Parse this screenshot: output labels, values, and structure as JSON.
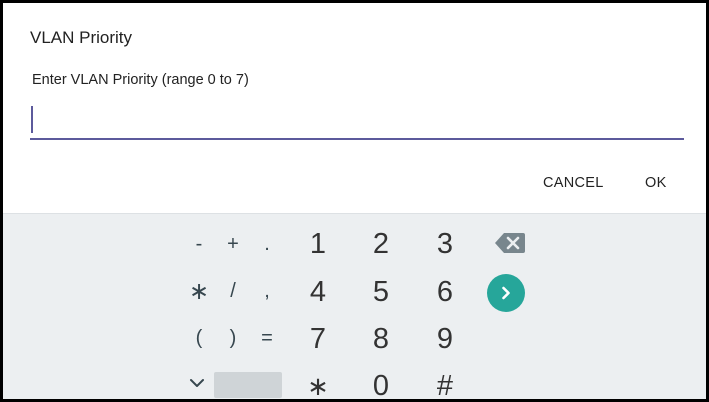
{
  "dialog": {
    "title": "VLAN Priority",
    "message": "Enter VLAN Priority (range 0 to 7)",
    "input_value": "",
    "cancel_label": "CANCEL",
    "ok_label": "OK"
  },
  "keyboard": {
    "row1": {
      "sym1": "-",
      "sym2": "+",
      "sym3": ".",
      "n1": "1",
      "n2": "2",
      "n3": "3"
    },
    "row2": {
      "sym1": "∗",
      "sym2": "/",
      "sym3": ",",
      "n1": "4",
      "n2": "5",
      "n3": "6"
    },
    "row3": {
      "sym1": "(",
      "sym2": ")",
      "sym3": "=",
      "n1": "7",
      "n2": "8",
      "n3": "9"
    },
    "row4": {
      "sym2": "∗",
      "n2": "0",
      "n3": "#"
    },
    "icons": {
      "backspace": "backspace-icon",
      "enter": "chevron-right-icon",
      "collapse": "chevron-down-icon"
    },
    "colors": {
      "background": "#eceff1",
      "enter": "#26a69a",
      "accent": "#5c5a9c"
    }
  }
}
